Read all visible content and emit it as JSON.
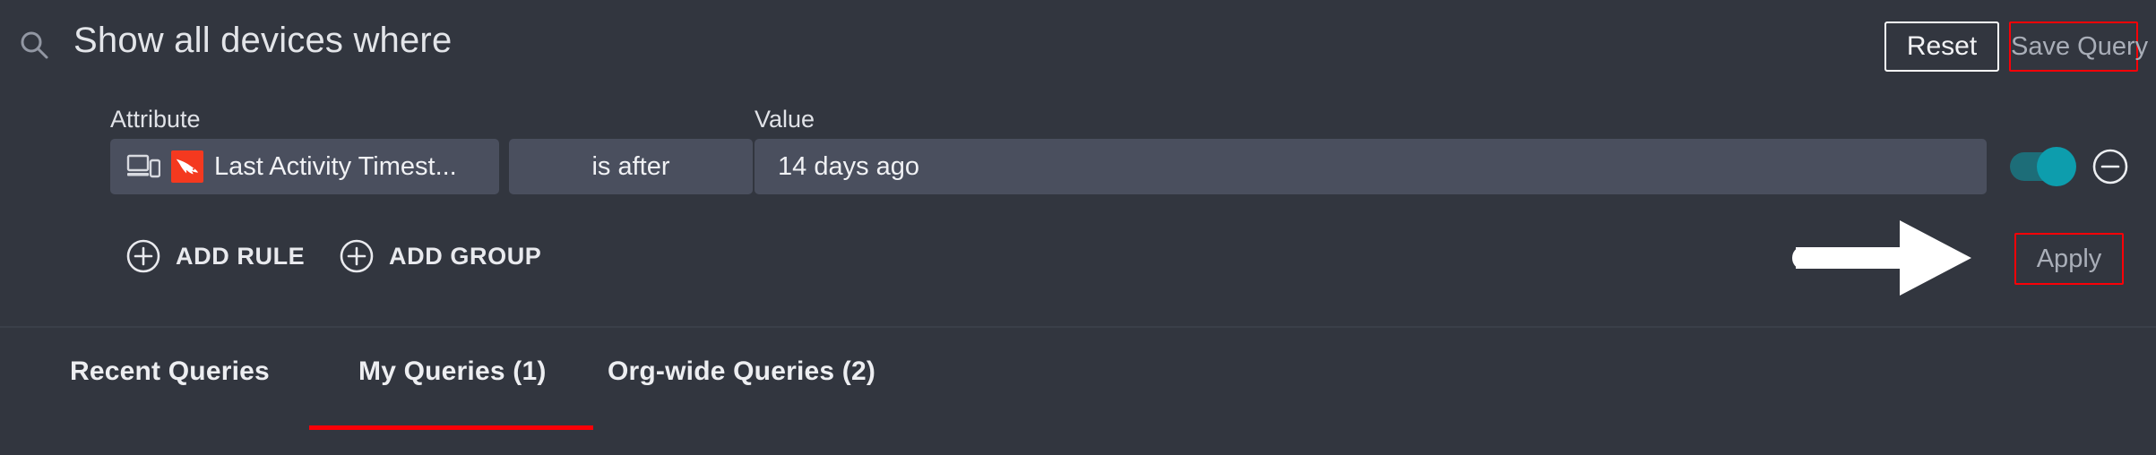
{
  "header": {
    "search_icon": "search-icon",
    "title": "Show all devices where",
    "reset_label": "Reset",
    "save_query_label": "Save Query"
  },
  "builder": {
    "labels": {
      "attribute": "Attribute",
      "value": "Value"
    },
    "rule": {
      "attribute_icon": "devices-icon",
      "brand_icon": "crowdstrike-falcon-logo",
      "attribute_value": "Last Activity Timest...",
      "operator_value": "is after",
      "value_value": "14 days ago",
      "toggle_state": "on",
      "remove_icon": "circle-minus-icon"
    },
    "add_rule_label": "ADD RULE",
    "add_group_label": "ADD GROUP",
    "add_icon": "circle-plus-icon",
    "apply_label": "Apply",
    "annotation_arrow": "right-arrow-annotation"
  },
  "tabs": [
    {
      "label": "Recent Queries",
      "active": false
    },
    {
      "label": "My Queries (1)",
      "active": true
    },
    {
      "label": "Org-wide Queries (2)",
      "active": false
    }
  ],
  "colors": {
    "background": "#32363f",
    "field_background": "#4a4f5e",
    "accent_red": "#fb0007",
    "brand_red": "#f4391f",
    "toggle_on": "#0d9dad",
    "text_primary": "#f0f1f4",
    "text_muted": "#a9aeb8"
  }
}
